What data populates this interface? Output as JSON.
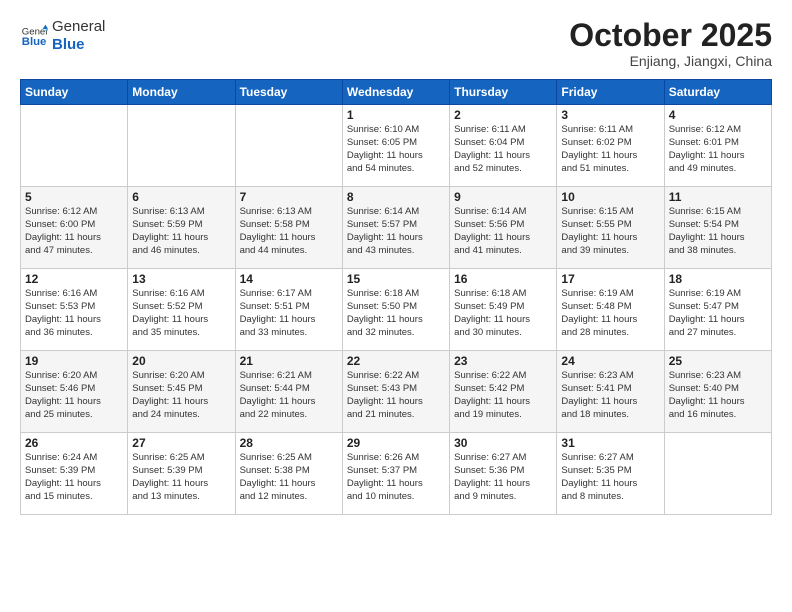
{
  "header": {
    "logo_line1": "General",
    "logo_line2": "Blue",
    "month": "October 2025",
    "location": "Enjiang, Jiangxi, China"
  },
  "weekdays": [
    "Sunday",
    "Monday",
    "Tuesday",
    "Wednesday",
    "Thursday",
    "Friday",
    "Saturday"
  ],
  "weeks": [
    [
      {
        "day": "",
        "info": ""
      },
      {
        "day": "",
        "info": ""
      },
      {
        "day": "",
        "info": ""
      },
      {
        "day": "1",
        "info": "Sunrise: 6:10 AM\nSunset: 6:05 PM\nDaylight: 11 hours\nand 54 minutes."
      },
      {
        "day": "2",
        "info": "Sunrise: 6:11 AM\nSunset: 6:04 PM\nDaylight: 11 hours\nand 52 minutes."
      },
      {
        "day": "3",
        "info": "Sunrise: 6:11 AM\nSunset: 6:02 PM\nDaylight: 11 hours\nand 51 minutes."
      },
      {
        "day": "4",
        "info": "Sunrise: 6:12 AM\nSunset: 6:01 PM\nDaylight: 11 hours\nand 49 minutes."
      }
    ],
    [
      {
        "day": "5",
        "info": "Sunrise: 6:12 AM\nSunset: 6:00 PM\nDaylight: 11 hours\nand 47 minutes."
      },
      {
        "day": "6",
        "info": "Sunrise: 6:13 AM\nSunset: 5:59 PM\nDaylight: 11 hours\nand 46 minutes."
      },
      {
        "day": "7",
        "info": "Sunrise: 6:13 AM\nSunset: 5:58 PM\nDaylight: 11 hours\nand 44 minutes."
      },
      {
        "day": "8",
        "info": "Sunrise: 6:14 AM\nSunset: 5:57 PM\nDaylight: 11 hours\nand 43 minutes."
      },
      {
        "day": "9",
        "info": "Sunrise: 6:14 AM\nSunset: 5:56 PM\nDaylight: 11 hours\nand 41 minutes."
      },
      {
        "day": "10",
        "info": "Sunrise: 6:15 AM\nSunset: 5:55 PM\nDaylight: 11 hours\nand 39 minutes."
      },
      {
        "day": "11",
        "info": "Sunrise: 6:15 AM\nSunset: 5:54 PM\nDaylight: 11 hours\nand 38 minutes."
      }
    ],
    [
      {
        "day": "12",
        "info": "Sunrise: 6:16 AM\nSunset: 5:53 PM\nDaylight: 11 hours\nand 36 minutes."
      },
      {
        "day": "13",
        "info": "Sunrise: 6:16 AM\nSunset: 5:52 PM\nDaylight: 11 hours\nand 35 minutes."
      },
      {
        "day": "14",
        "info": "Sunrise: 6:17 AM\nSunset: 5:51 PM\nDaylight: 11 hours\nand 33 minutes."
      },
      {
        "day": "15",
        "info": "Sunrise: 6:18 AM\nSunset: 5:50 PM\nDaylight: 11 hours\nand 32 minutes."
      },
      {
        "day": "16",
        "info": "Sunrise: 6:18 AM\nSunset: 5:49 PM\nDaylight: 11 hours\nand 30 minutes."
      },
      {
        "day": "17",
        "info": "Sunrise: 6:19 AM\nSunset: 5:48 PM\nDaylight: 11 hours\nand 28 minutes."
      },
      {
        "day": "18",
        "info": "Sunrise: 6:19 AM\nSunset: 5:47 PM\nDaylight: 11 hours\nand 27 minutes."
      }
    ],
    [
      {
        "day": "19",
        "info": "Sunrise: 6:20 AM\nSunset: 5:46 PM\nDaylight: 11 hours\nand 25 minutes."
      },
      {
        "day": "20",
        "info": "Sunrise: 6:20 AM\nSunset: 5:45 PM\nDaylight: 11 hours\nand 24 minutes."
      },
      {
        "day": "21",
        "info": "Sunrise: 6:21 AM\nSunset: 5:44 PM\nDaylight: 11 hours\nand 22 minutes."
      },
      {
        "day": "22",
        "info": "Sunrise: 6:22 AM\nSunset: 5:43 PM\nDaylight: 11 hours\nand 21 minutes."
      },
      {
        "day": "23",
        "info": "Sunrise: 6:22 AM\nSunset: 5:42 PM\nDaylight: 11 hours\nand 19 minutes."
      },
      {
        "day": "24",
        "info": "Sunrise: 6:23 AM\nSunset: 5:41 PM\nDaylight: 11 hours\nand 18 minutes."
      },
      {
        "day": "25",
        "info": "Sunrise: 6:23 AM\nSunset: 5:40 PM\nDaylight: 11 hours\nand 16 minutes."
      }
    ],
    [
      {
        "day": "26",
        "info": "Sunrise: 6:24 AM\nSunset: 5:39 PM\nDaylight: 11 hours\nand 15 minutes."
      },
      {
        "day": "27",
        "info": "Sunrise: 6:25 AM\nSunset: 5:39 PM\nDaylight: 11 hours\nand 13 minutes."
      },
      {
        "day": "28",
        "info": "Sunrise: 6:25 AM\nSunset: 5:38 PM\nDaylight: 11 hours\nand 12 minutes."
      },
      {
        "day": "29",
        "info": "Sunrise: 6:26 AM\nSunset: 5:37 PM\nDaylight: 11 hours\nand 10 minutes."
      },
      {
        "day": "30",
        "info": "Sunrise: 6:27 AM\nSunset: 5:36 PM\nDaylight: 11 hours\nand 9 minutes."
      },
      {
        "day": "31",
        "info": "Sunrise: 6:27 AM\nSunset: 5:35 PM\nDaylight: 11 hours\nand 8 minutes."
      },
      {
        "day": "",
        "info": ""
      }
    ]
  ]
}
